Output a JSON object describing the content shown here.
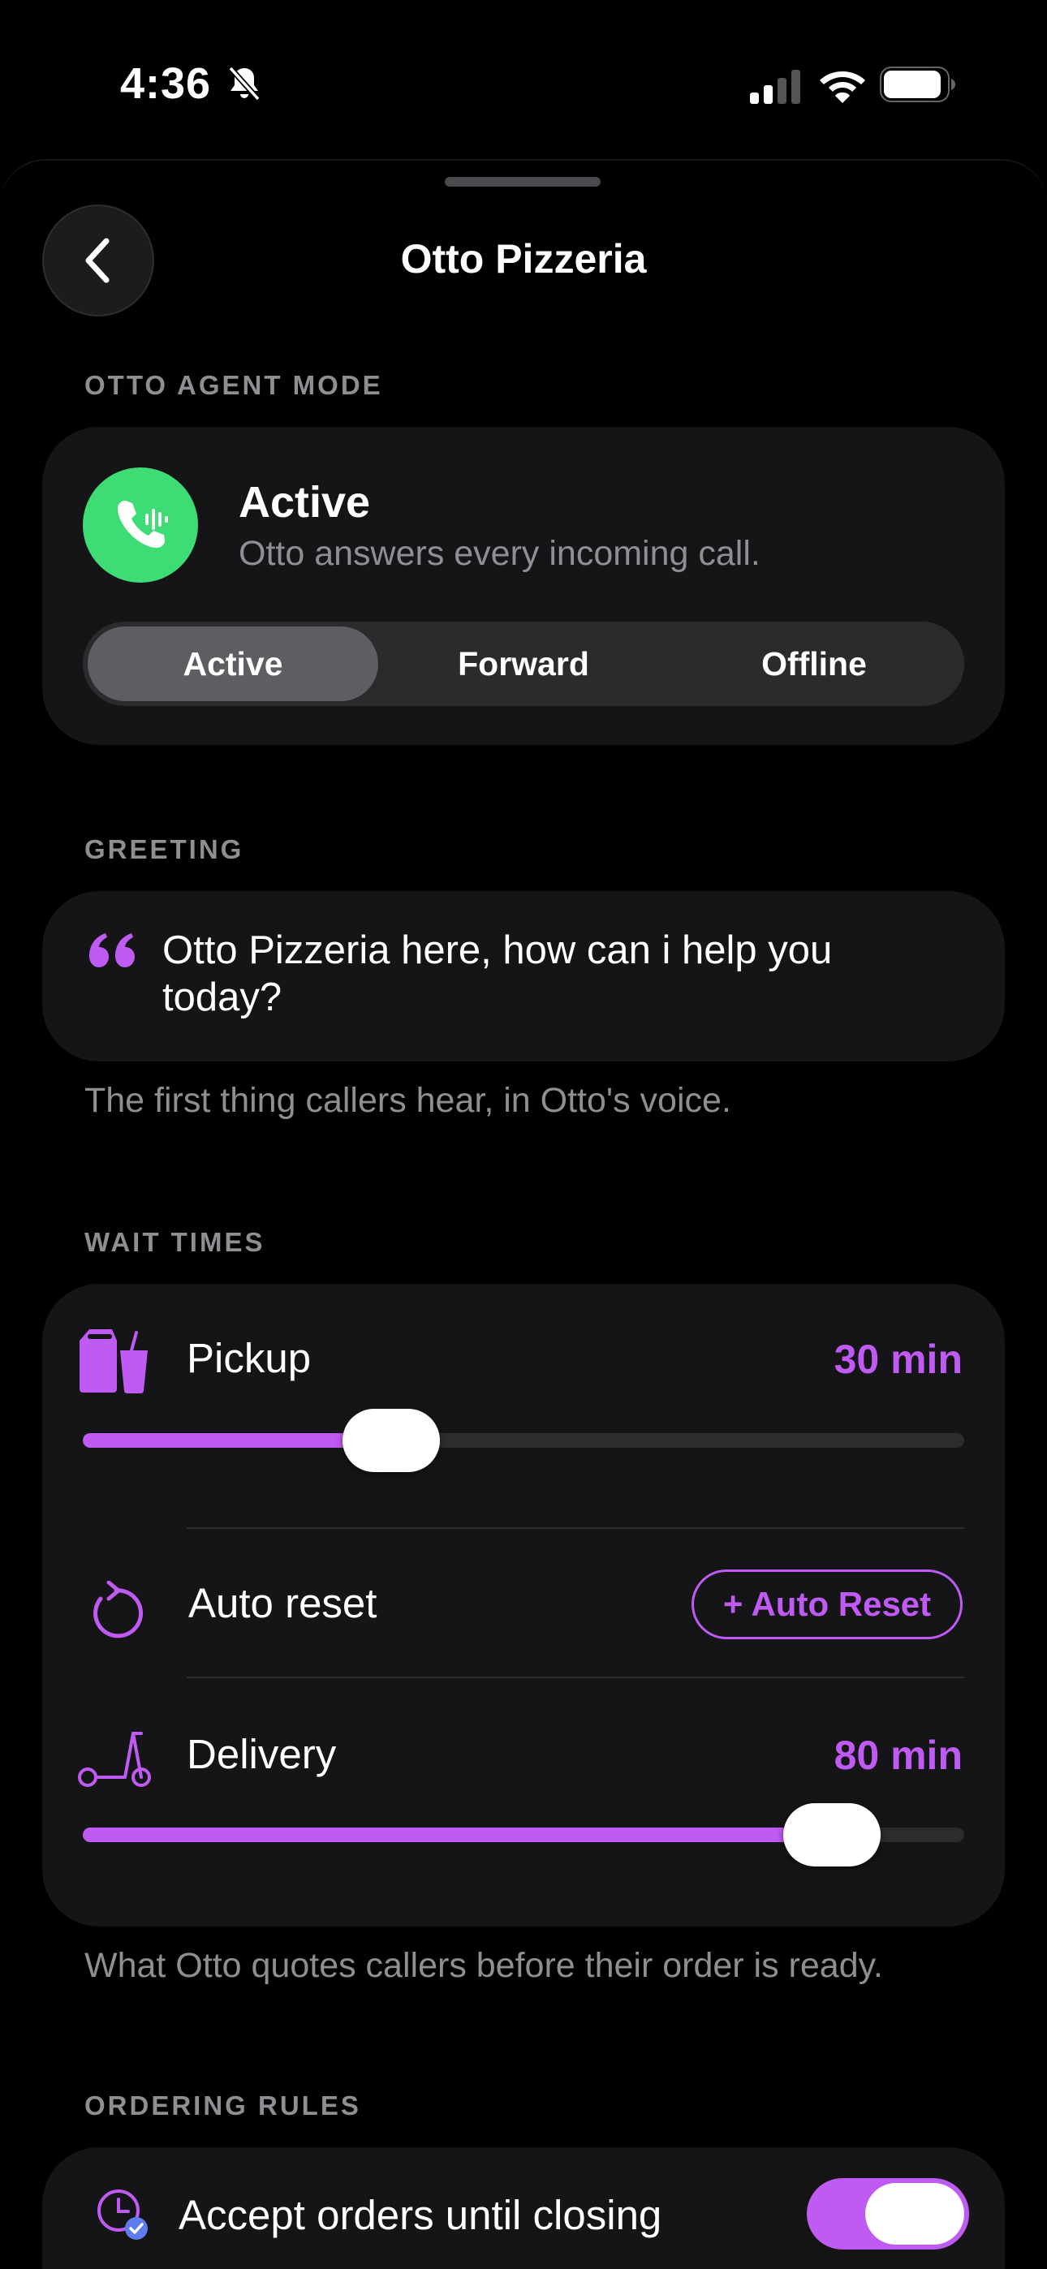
{
  "status_bar": {
    "time": "4:36"
  },
  "nav": {
    "title": "Otto Pizzeria"
  },
  "agent_mode": {
    "section_label": "OTTO AGENT MODE",
    "status_title": "Active",
    "status_description": "Otto answers every incoming call.",
    "segments": [
      "Active",
      "Forward",
      "Offline"
    ],
    "selected": "Active",
    "status_color": "#3ddc74"
  },
  "greeting": {
    "section_label": "GREETING",
    "text": "Otto Pizzeria here, how can i help you today?",
    "caption": "The first thing callers hear, in Otto's voice."
  },
  "wait_times": {
    "section_label": "WAIT TIMES",
    "pickup": {
      "label": "Pickup",
      "value": "30 min",
      "slider_fraction": 0.35
    },
    "auto_reset": {
      "label": "Auto reset",
      "button_label": "+ Auto Reset"
    },
    "delivery": {
      "label": "Delivery",
      "value": "80 min",
      "slider_fraction": 0.85
    },
    "caption": "What Otto quotes callers before their order is ready."
  },
  "ordering_rules": {
    "section_label": "ORDERING RULES",
    "accept_until_closing": {
      "label": "Accept orders until closing",
      "enabled": true
    }
  },
  "accent_color": "#bf5af2"
}
